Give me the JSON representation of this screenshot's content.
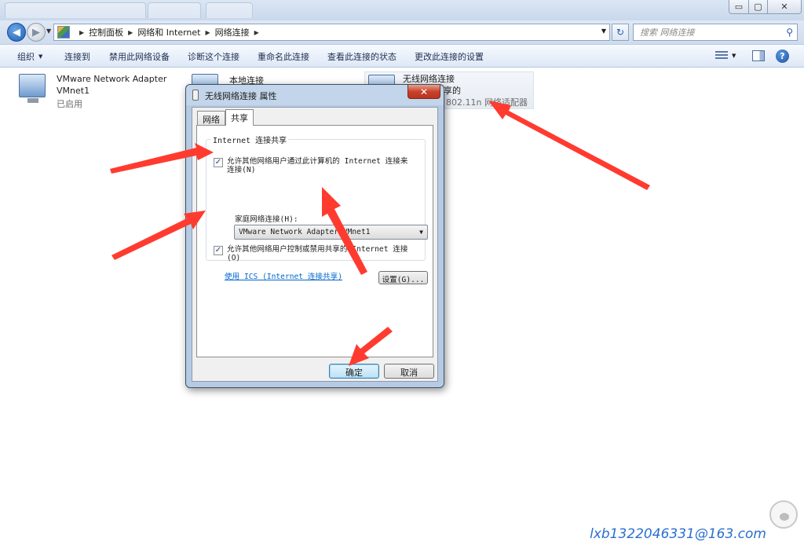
{
  "window": {
    "title_tab_text": "",
    "controls": {
      "minimize": "▭",
      "maximize": "▢",
      "close": "✕"
    }
  },
  "address_bar": {
    "breadcrumbs": [
      "控制面板",
      "网络和 Internet",
      "网络连接"
    ],
    "search_placeholder": "搜索 网络连接"
  },
  "command_bar": {
    "items": [
      "组织",
      "连接到",
      "禁用此网络设备",
      "诊断这个连接",
      "重命名此连接",
      "查看此连接的状态",
      "更改此连接的设置"
    ],
    "help_label": "?"
  },
  "adapters": [
    {
      "name": "VMware Network Adapter",
      "sub": "VMnet1",
      "status": "已启用"
    },
    {
      "name": "本地连接",
      "sub": "",
      "status": ""
    },
    {
      "name": "无线网络连接",
      "sub": "享的",
      "status": "802.11n 网络适配器"
    }
  ],
  "dialog": {
    "title": "无线网络连接 属性",
    "close_label": "✕",
    "tabs": [
      "网络",
      "共享"
    ],
    "active_tab": "共享",
    "group_label": "Internet 连接共享",
    "allow_connect_label": "允许其他网络用户通过此计算机的 Internet 连接来连接(N)",
    "allow_connect_checked": true,
    "home_network_label": "家庭网络连接(H):",
    "home_network_value": "VMware Network Adapter VMnet1",
    "allow_control_label": "允许其他网络用户控制或禁用共享的 Internet 连接(O)",
    "allow_control_checked": true,
    "ics_link": "使用 ICS (Internet 连接共享)",
    "settings_button": "设置(G)...",
    "ok_button": "确定",
    "cancel_button": "取消"
  },
  "watermark": "lxb1322046331@163.com",
  "colors": {
    "annotation_arrow": "#ff3b30",
    "link": "#0066cc",
    "watermark": "#2b6fcf"
  }
}
